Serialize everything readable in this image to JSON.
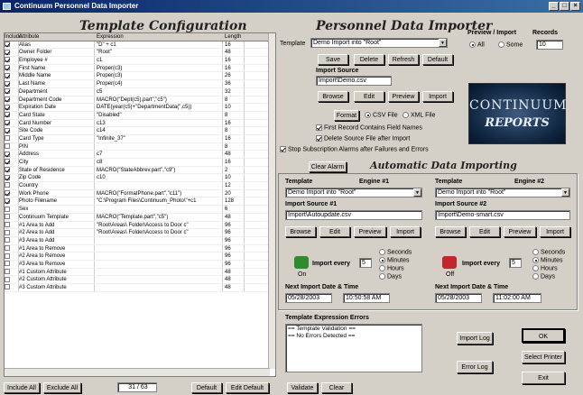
{
  "window": {
    "title": "Continuum Personnel Data Importer"
  },
  "left": {
    "heading": "Template Configuration",
    "columns": [
      "Include",
      "Attribute",
      "Expression",
      "Length"
    ],
    "rows": [
      {
        "on": true,
        "attr": "Alias",
        "expr": "\"D\" + c1",
        "len": "16"
      },
      {
        "on": true,
        "attr": "Owner Folder",
        "expr": "\"Root\"",
        "len": "48"
      },
      {
        "on": true,
        "attr": "Employee #",
        "expr": "c1",
        "len": "16"
      },
      {
        "on": true,
        "attr": "First Name",
        "expr": "Proper(c3)",
        "len": "16"
      },
      {
        "on": true,
        "attr": "Middle Name",
        "expr": "Proper(c3)",
        "len": "26"
      },
      {
        "on": true,
        "attr": "Last Name",
        "expr": "Proper(c4)",
        "len": "36"
      },
      {
        "on": true,
        "attr": "Department",
        "expr": "c5",
        "len": "32"
      },
      {
        "on": true,
        "attr": "Department Code",
        "expr": "MACRO(\"Dept(c5).part\",\"c5\")",
        "len": "8"
      },
      {
        "on": true,
        "attr": "Expiration Date",
        "expr": "DATE(year(c5)+\"DepartmentData(\",c5))",
        "len": "10"
      },
      {
        "on": true,
        "attr": "Card State",
        "expr": "\"Disabled\"",
        "len": "8"
      },
      {
        "on": true,
        "attr": "Card Number",
        "expr": "c13",
        "len": "16"
      },
      {
        "on": true,
        "attr": "Site Code",
        "expr": "c14",
        "len": "8"
      },
      {
        "on": false,
        "attr": "Card Type",
        "expr": "\"Infinite_37\"",
        "len": "16"
      },
      {
        "on": false,
        "attr": "PIN",
        "expr": "",
        "len": "8"
      },
      {
        "on": true,
        "attr": "Address",
        "expr": "c7",
        "len": "48"
      },
      {
        "on": true,
        "attr": "City",
        "expr": "c8",
        "len": "16"
      },
      {
        "on": true,
        "attr": "State of Residence",
        "expr": "MACRO(\"StateAbbrev.part\",\"c9\")",
        "len": "2"
      },
      {
        "on": true,
        "attr": "Zip Code",
        "expr": "c10",
        "len": "10"
      },
      {
        "on": false,
        "attr": "Country",
        "expr": "",
        "len": "12"
      },
      {
        "on": true,
        "attr": "Work Phone",
        "expr": "MACRO(\"FormatPhone.part\",\"c11\")",
        "len": "20"
      },
      {
        "on": true,
        "attr": "Photo Filename",
        "expr": "\"C:\\Program Files\\Continuum_Photo\\\"+c1",
        "len": "128"
      },
      {
        "on": false,
        "attr": "Sex",
        "expr": "",
        "len": "6"
      },
      {
        "on": false,
        "attr": "Continuum Template",
        "expr": "MACRO(\"Template.part\",\"c5\")",
        "len": "48"
      },
      {
        "on": false,
        "attr": "#1 Area to Add",
        "expr": "\"Root\\Areas\\ Folder\\Access to Door c\"",
        "len": "96"
      },
      {
        "on": false,
        "attr": "#2 Area to Add",
        "expr": "\"Root\\Areas\\ Folder\\Access to Door c\"",
        "len": "96"
      },
      {
        "on": false,
        "attr": "#3 Area to Add",
        "expr": "",
        "len": "96"
      },
      {
        "on": false,
        "attr": "#1 Area to Remove",
        "expr": "",
        "len": "96"
      },
      {
        "on": false,
        "attr": "#2 Area to Remove",
        "expr": "",
        "len": "96"
      },
      {
        "on": false,
        "attr": "#3 Area to Remove",
        "expr": "",
        "len": "96"
      },
      {
        "on": false,
        "attr": "#1 Custom Attribute",
        "expr": "",
        "len": "48"
      },
      {
        "on": false,
        "attr": "#2 Custom Attribute",
        "expr": "",
        "len": "48"
      },
      {
        "on": false,
        "attr": "#3 Custom Attribute",
        "expr": "",
        "len": "48"
      }
    ],
    "include_all": "Include All",
    "exclude_all": "Exclude All",
    "count_display": "31 / 63",
    "default_btn": "Default",
    "edit_default": "Edit Default"
  },
  "right": {
    "heading": "Personnel Data Importer",
    "template_label": "Template",
    "template_value": "Demo Import into \"Root\"",
    "save": "Save",
    "delete": "Delete",
    "refresh": "Refresh",
    "default": "Default",
    "import_source_label": "Import Source",
    "import_source_value": "Import\\Demo.csv",
    "browse": "Browse",
    "edit": "Edit",
    "preview": "Preview",
    "import": "Import",
    "format_btn": "Format",
    "csv_label": "CSV File",
    "xml_label": "XML File",
    "first_record": "First Record Contains Field Names",
    "delete_source": "Delete Source File after Import",
    "stop_subscription": "Stop Subscription Alarms after Failures and Errors",
    "preview_import_label": "Preview / Import",
    "records_label": "Records",
    "all_label": "All",
    "some_label": "Some",
    "records_value": "10",
    "clear_alarm": "Clear Alarm",
    "auto_heading": "Automatic Data Importing",
    "engine1": {
      "template_label": "Template",
      "engine_label": "Engine #1",
      "template_value": "Demo Import into \"Root\"",
      "source_label": "Import Source #1",
      "source_value": "Import\\Autoupdate.csv",
      "browse": "Browse",
      "edit": "Edit",
      "preview": "Preview",
      "import": "Import",
      "import_every": "Import every",
      "every_value": "5",
      "status": "On",
      "units": [
        "Seconds",
        "Minutes",
        "Hours",
        "Days"
      ],
      "selected_unit": "Minutes",
      "next_label": "Next Import Date & Time",
      "date": "05/28/2003",
      "time": "10:50:58 AM",
      "color": "#2e8b2e"
    },
    "engine2": {
      "template_label": "Template",
      "engine_label": "Engine #2",
      "template_value": "Demo Import into \"Root\"",
      "source_label": "Import Source #2",
      "source_value": "Import\\Demo-smart.csv",
      "browse": "Browse",
      "edit": "Edit",
      "preview": "Preview",
      "import": "Import",
      "import_every": "Import every",
      "every_value": "5",
      "status": "Off",
      "units": [
        "Seconds",
        "Minutes",
        "Hours",
        "Days"
      ],
      "selected_unit": "Minutes",
      "next_label": "Next Import Date & Time",
      "date": "05/28/2003",
      "time": "11:02:00 AM",
      "color": "#c0262c"
    },
    "errors_label": "Template Expression Errors",
    "errors_text": [
      "== Template Validation ==",
      "== No Errors Detected =="
    ],
    "validate": "Validate",
    "clear": "Clear",
    "import_log": "Import Log",
    "error_log": "Error Log",
    "ok": "OK",
    "select_printer": "Select Printer",
    "exit": "Exit",
    "logo_line1": "CONTINUUM",
    "logo_line2": "REPORTS"
  }
}
